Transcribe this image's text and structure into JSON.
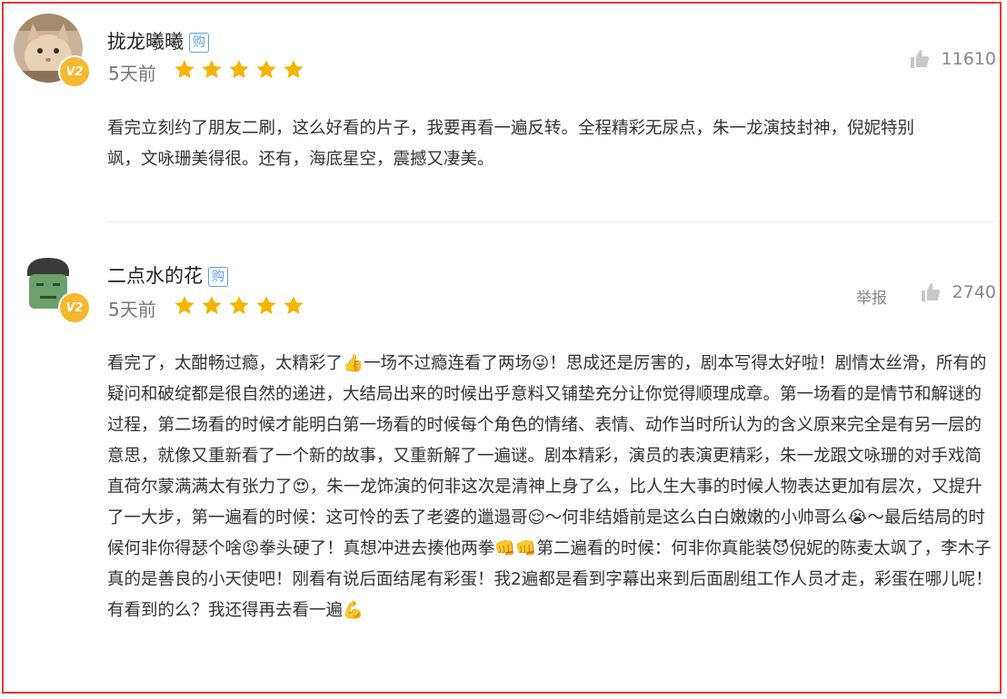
{
  "reviews": [
    {
      "username": "拢龙曦曦",
      "buy_label": "购",
      "level": "V2",
      "time": "5天前",
      "rating": 5,
      "likes": "11610",
      "content": "看完立刻约了朋友二刷，这么好看的片子，我要再看一遍反转。全程精彩无尿点，朱一龙演技封神，倪妮特别飒，文咏珊美得很。还有，海底星空，震撼又凄美。"
    },
    {
      "username": "二点水的花",
      "buy_label": "购",
      "level": "V2",
      "time": "5天前",
      "rating": 5,
      "report_label": "举报",
      "likes": "2740",
      "content": "看完了，太酣畅过瘾，太精彩了👍一场不过瘾连看了两场😜！思成还是厉害的，剧本写得太好啦！剧情太丝滑，所有的疑问和破绽都是很自然的递进，大结局出来的时候出乎意料又铺垫充分让你觉得顺理成章。第一场看的是情节和解谜的过程，第二场看的时候才能明白第一场看的时候每个角色的情绪、表情、动作当时所认为的含义原来完全是有另一层的意思，就像又重新看了一个新的故事，又重新解了一遍谜。剧本精彩，演员的表演更精彩，朱一龙跟文咏珊的对手戏简直荷尔蒙满满太有张力了😍，朱一龙饰演的何非这次是清神上身了么，比人生大事的时候人物表达更加有层次，又提升了一大步，第一遍看的时候：这可怜的丢了老婆的邋遢哥😌～何非结婚前是这么白白嫩嫩的小帅哥么😭～最后结局的时候何非你得瑟个啥😡拳头硬了！真想冲进去揍他两拳👊👊第二遍看的时候：何非你真能装😈倪妮的陈麦太飒了，李木子真的是善良的小天使吧！刚看有说后面结尾有彩蛋！我2遍都是看到字幕出来到后面剧组工作人员才走，彩蛋在哪儿呢！有看到的么？我还得再去看一遍💪"
    }
  ],
  "colors": {
    "star": "#f5b400",
    "border": "#e53935",
    "badge": "#f5b82e",
    "buy": "#5aa0e0"
  }
}
